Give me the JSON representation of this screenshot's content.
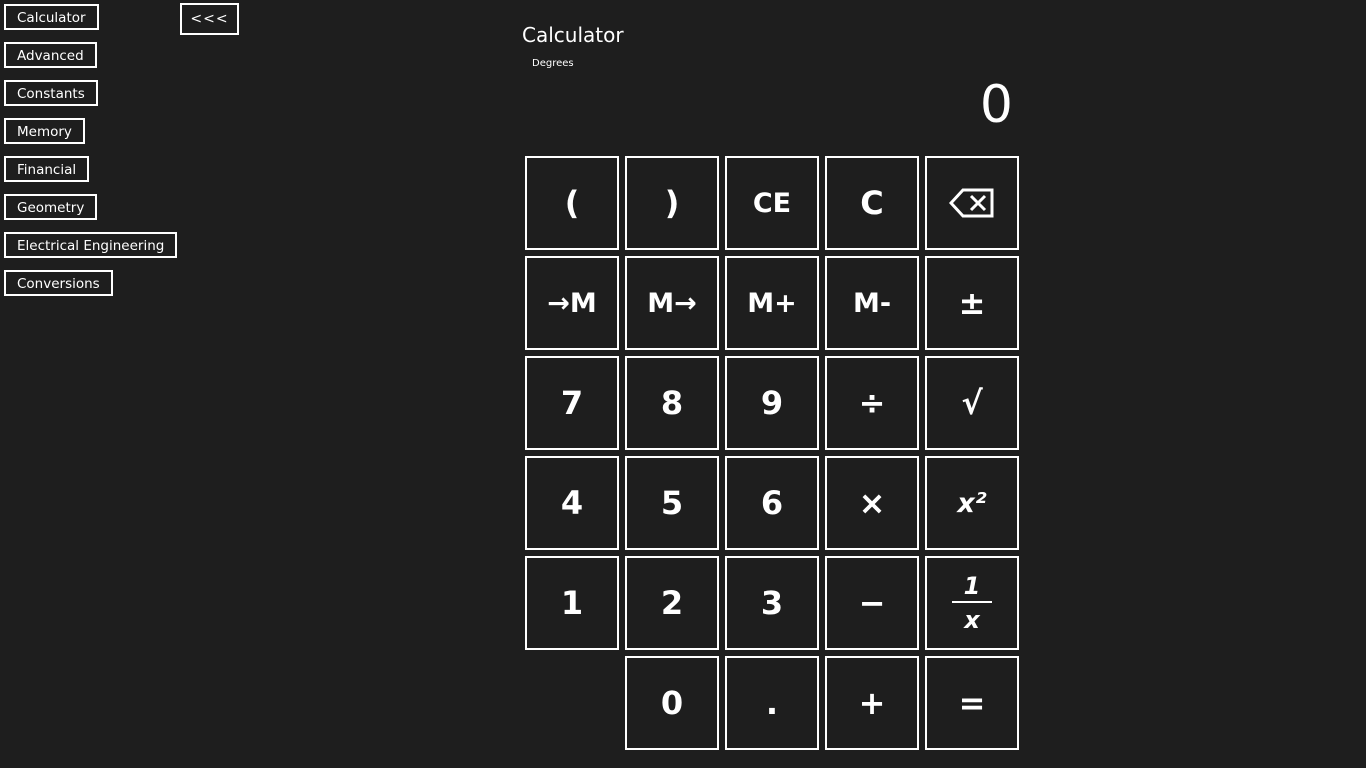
{
  "sidebar": {
    "items": [
      {
        "label": "Calculator"
      },
      {
        "label": "Advanced"
      },
      {
        "label": "Constants"
      },
      {
        "label": "Memory"
      },
      {
        "label": "Financial"
      },
      {
        "label": "Geometry"
      },
      {
        "label": "Electrical Engineering"
      },
      {
        "label": "Conversions"
      }
    ],
    "collapse_label": "<<<"
  },
  "header": {
    "title": "Calculator",
    "angle_mode": "Degrees"
  },
  "display": {
    "value": "0"
  },
  "keypad": {
    "row1": [
      "(",
      ")",
      "CE",
      "C",
      "⌫"
    ],
    "row2": [
      "→M",
      "M→",
      "M+",
      "M-",
      "±"
    ],
    "row3": [
      "7",
      "8",
      "9",
      "÷",
      "√"
    ],
    "row4": [
      "4",
      "5",
      "6",
      "×",
      "x²"
    ],
    "row5": [
      "1",
      "2",
      "3",
      "−"
    ],
    "reciprocal": {
      "numerator": "1",
      "denominator": "x"
    },
    "row6": [
      "0",
      ".",
      "+",
      "="
    ]
  },
  "colors": {
    "background": "#1e1e1e",
    "foreground": "#ffffff"
  }
}
